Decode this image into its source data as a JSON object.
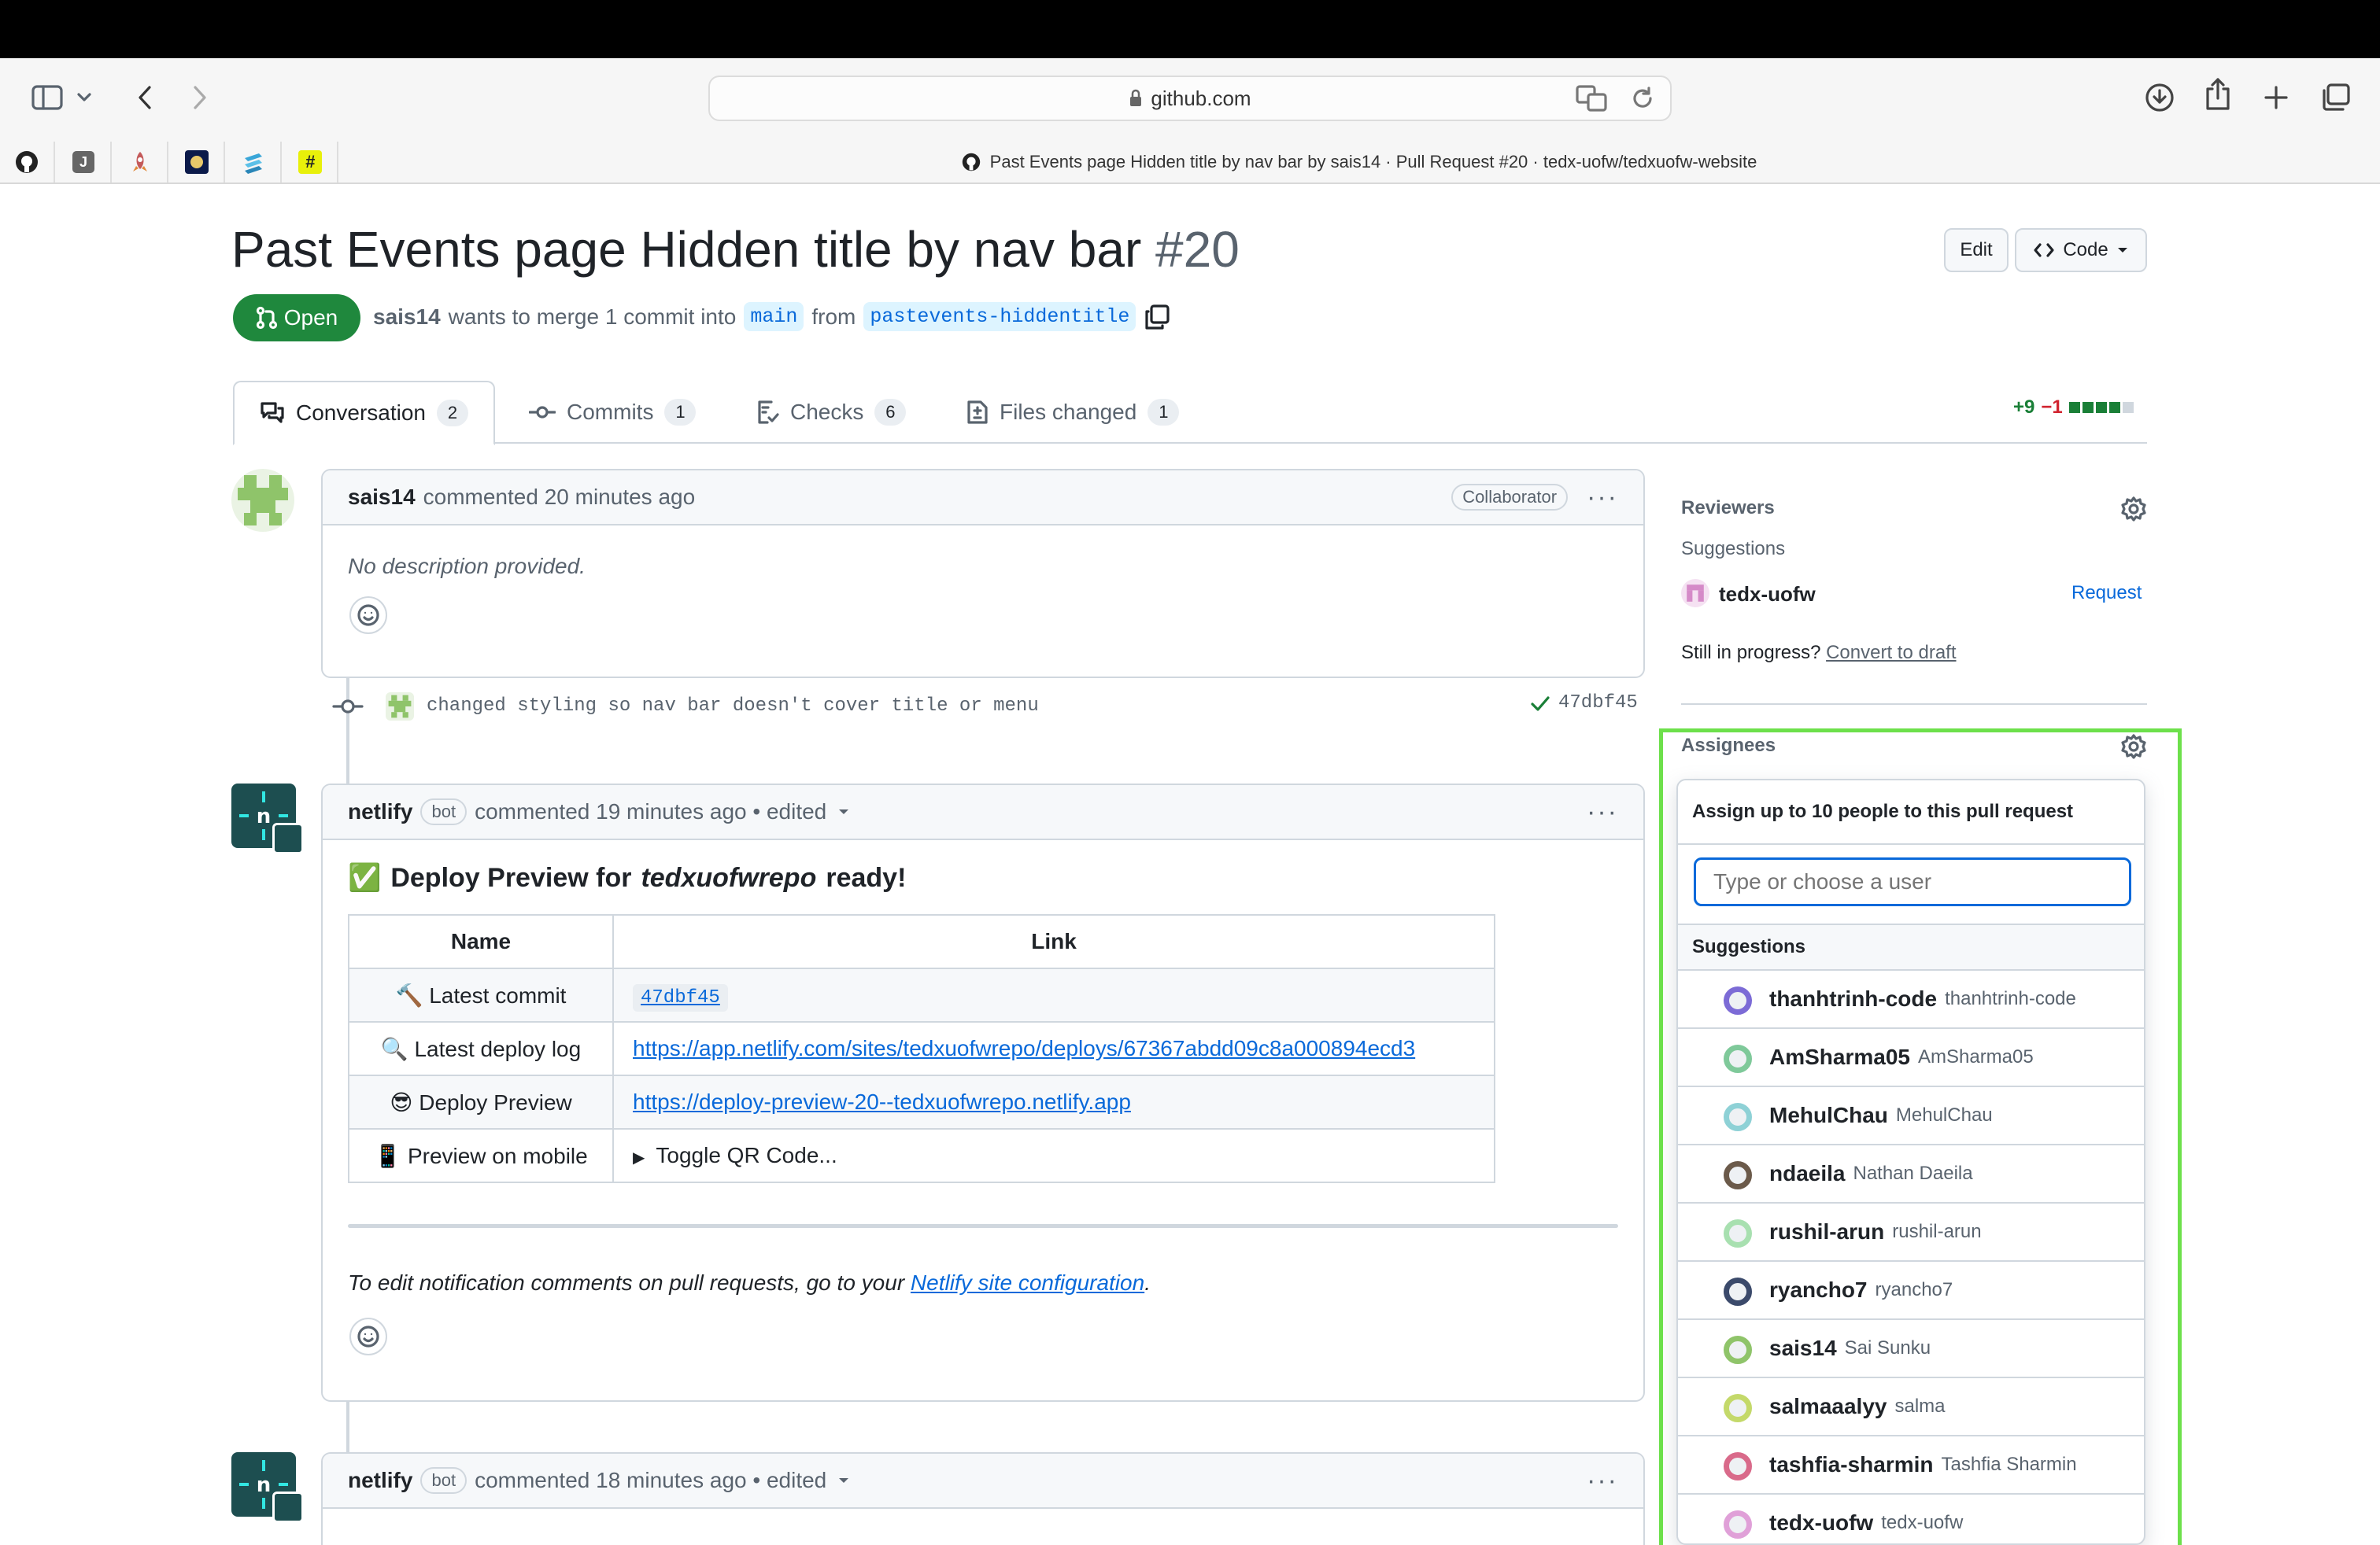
{
  "browser": {
    "url": "github.com",
    "tab_title": "Past Events page Hidden title by nav bar by sais14 · Pull Request #20 · tedx-uofw/tedxuofw-website"
  },
  "pr": {
    "title": "Past Events page Hidden title by nav bar",
    "number": "#20",
    "state": "Open",
    "author": "sais14",
    "merge_text": "wants to merge 1 commit into",
    "base": "main",
    "from_text": "from",
    "head": "pastevents-hiddentitle",
    "edit_label": "Edit",
    "code_label": "Code"
  },
  "tabs": [
    {
      "label": "Conversation",
      "count": "2"
    },
    {
      "label": "Commits",
      "count": "1"
    },
    {
      "label": "Checks",
      "count": "6"
    },
    {
      "label": "Files changed",
      "count": "1"
    }
  ],
  "diffstat": {
    "add": "+9",
    "del": "−1"
  },
  "comment1": {
    "author": "sais14",
    "meta": "commented 20 minutes ago",
    "role": "Collaborator",
    "body": "No description provided."
  },
  "commit": {
    "message": "changed styling so nav bar doesn't cover title or menu",
    "sha": "47dbf45"
  },
  "comment2": {
    "author": "netlify",
    "bot": "bot",
    "meta": "commented 19 minutes ago • edited",
    "heading_emoji": "✅",
    "heading_pre": "Deploy Preview for",
    "heading_site": "tedxuofwrepo",
    "heading_post": "ready!",
    "table_headers": [
      "Name",
      "Link"
    ],
    "rows": [
      {
        "icon": "🔨",
        "name": "Latest commit",
        "link": "47dbf45"
      },
      {
        "icon": "🔍",
        "name": "Latest deploy log",
        "link": "https://app.netlify.com/sites/tedxuofwrepo/deploys/67367abdd09c8a000894ecd3"
      },
      {
        "icon": "😎",
        "name": "Deploy Preview",
        "link": "https://deploy-preview-20--tedxuofwrepo.netlify.app"
      },
      {
        "icon": "📱",
        "name": "Preview on mobile",
        "link": "Toggle QR Code..."
      }
    ],
    "footer_pre": "To edit notification comments on pull requests, go to your",
    "footer_link": "Netlify site configuration",
    "footer_post": "."
  },
  "comment3": {
    "author": "netlify",
    "bot": "bot",
    "meta": "commented 18 minutes ago • edited"
  },
  "sidebar": {
    "reviewers_label": "Reviewers",
    "suggestions_label": "Suggestions",
    "reviewer_suggestion": "tedx-uofw",
    "request_label": "Request",
    "still_text": "Still in progress?",
    "convert_label": "Convert to draft",
    "assignees_label": "Assignees"
  },
  "assign_popup": {
    "title": "Assign up to 10 people to this pull request",
    "placeholder": "Type or choose a user",
    "suggestions_label": "Suggestions",
    "users": [
      {
        "login": "thanhtrinh-code",
        "name": "thanhtrinh-code",
        "color": "#7c6bd6"
      },
      {
        "login": "AmSharma05",
        "name": "AmSharma05",
        "color": "#7fc99a"
      },
      {
        "login": "MehulChau",
        "name": "MehulChau",
        "color": "#8ed1d6"
      },
      {
        "login": "ndaeila",
        "name": "Nathan Daeila",
        "color": "#6b5a4a"
      },
      {
        "login": "rushil-arun",
        "name": "rushil-arun",
        "color": "#a8e0b0"
      },
      {
        "login": "ryancho7",
        "name": "ryancho7",
        "color": "#3b4a6b"
      },
      {
        "login": "sais14",
        "name": "Sai Sunku",
        "color": "#8fc46a"
      },
      {
        "login": "salmaaalyy",
        "name": "salma",
        "color": "#c4d96a"
      },
      {
        "login": "tashfia-sharmin",
        "name": "Tashfia Sharmin",
        "color": "#d96a8a"
      },
      {
        "login": "tedx-uofw",
        "name": "tedx-uofw",
        "color": "#e0a0d8"
      }
    ]
  }
}
